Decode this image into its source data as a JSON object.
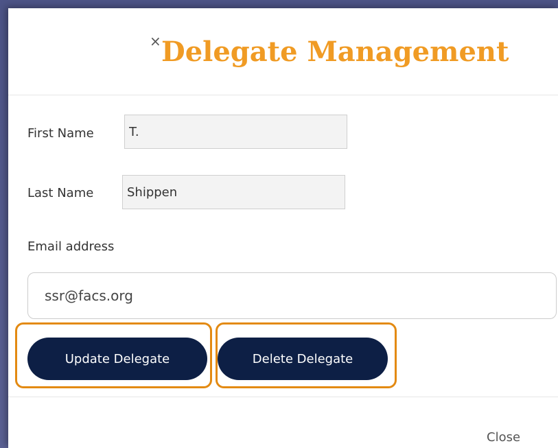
{
  "modal": {
    "title": "Delegate Management",
    "close_glyph": "×"
  },
  "form": {
    "first_name": {
      "label": "First Name",
      "value": "T."
    },
    "last_name": {
      "label": "Last Name",
      "value": "Shippen"
    },
    "email": {
      "label": "Email address",
      "value": "ssr@facs.org"
    }
  },
  "actions": {
    "update_label": "Update Delegate",
    "delete_label": "Delete Delegate"
  },
  "footer": {
    "close_label": "Close"
  },
  "colors": {
    "title": "#f09b24",
    "button_bg": "#0d1f45",
    "highlight": "#e38a12"
  }
}
